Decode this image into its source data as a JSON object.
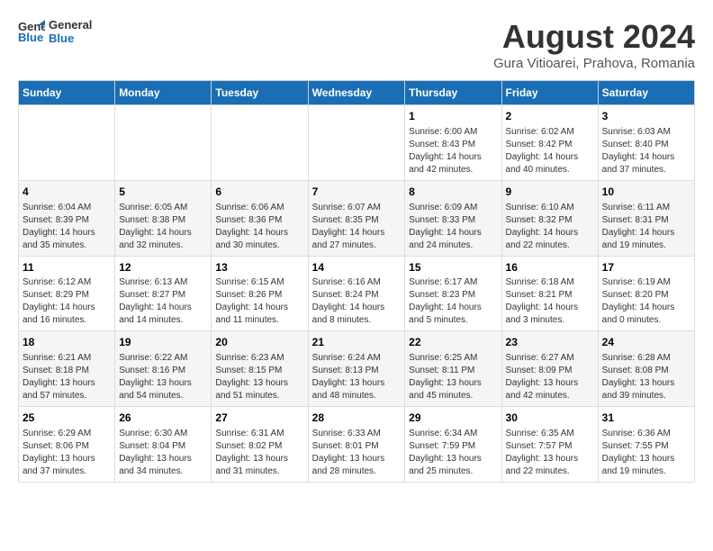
{
  "logo": {
    "line1": "General",
    "line2": "Blue"
  },
  "title": "August 2024",
  "subtitle": "Gura Vitioarei, Prahova, Romania",
  "header_days": [
    "Sunday",
    "Monday",
    "Tuesday",
    "Wednesday",
    "Thursday",
    "Friday",
    "Saturday"
  ],
  "weeks": [
    [
      {
        "day": "",
        "info": ""
      },
      {
        "day": "",
        "info": ""
      },
      {
        "day": "",
        "info": ""
      },
      {
        "day": "",
        "info": ""
      },
      {
        "day": "1",
        "info": "Sunrise: 6:00 AM\nSunset: 8:43 PM\nDaylight: 14 hours\nand 42 minutes."
      },
      {
        "day": "2",
        "info": "Sunrise: 6:02 AM\nSunset: 8:42 PM\nDaylight: 14 hours\nand 40 minutes."
      },
      {
        "day": "3",
        "info": "Sunrise: 6:03 AM\nSunset: 8:40 PM\nDaylight: 14 hours\nand 37 minutes."
      }
    ],
    [
      {
        "day": "4",
        "info": "Sunrise: 6:04 AM\nSunset: 8:39 PM\nDaylight: 14 hours\nand 35 minutes."
      },
      {
        "day": "5",
        "info": "Sunrise: 6:05 AM\nSunset: 8:38 PM\nDaylight: 14 hours\nand 32 minutes."
      },
      {
        "day": "6",
        "info": "Sunrise: 6:06 AM\nSunset: 8:36 PM\nDaylight: 14 hours\nand 30 minutes."
      },
      {
        "day": "7",
        "info": "Sunrise: 6:07 AM\nSunset: 8:35 PM\nDaylight: 14 hours\nand 27 minutes."
      },
      {
        "day": "8",
        "info": "Sunrise: 6:09 AM\nSunset: 8:33 PM\nDaylight: 14 hours\nand 24 minutes."
      },
      {
        "day": "9",
        "info": "Sunrise: 6:10 AM\nSunset: 8:32 PM\nDaylight: 14 hours\nand 22 minutes."
      },
      {
        "day": "10",
        "info": "Sunrise: 6:11 AM\nSunset: 8:31 PM\nDaylight: 14 hours\nand 19 minutes."
      }
    ],
    [
      {
        "day": "11",
        "info": "Sunrise: 6:12 AM\nSunset: 8:29 PM\nDaylight: 14 hours\nand 16 minutes."
      },
      {
        "day": "12",
        "info": "Sunrise: 6:13 AM\nSunset: 8:27 PM\nDaylight: 14 hours\nand 14 minutes."
      },
      {
        "day": "13",
        "info": "Sunrise: 6:15 AM\nSunset: 8:26 PM\nDaylight: 14 hours\nand 11 minutes."
      },
      {
        "day": "14",
        "info": "Sunrise: 6:16 AM\nSunset: 8:24 PM\nDaylight: 14 hours\nand 8 minutes."
      },
      {
        "day": "15",
        "info": "Sunrise: 6:17 AM\nSunset: 8:23 PM\nDaylight: 14 hours\nand 5 minutes."
      },
      {
        "day": "16",
        "info": "Sunrise: 6:18 AM\nSunset: 8:21 PM\nDaylight: 14 hours\nand 3 minutes."
      },
      {
        "day": "17",
        "info": "Sunrise: 6:19 AM\nSunset: 8:20 PM\nDaylight: 14 hours\nand 0 minutes."
      }
    ],
    [
      {
        "day": "18",
        "info": "Sunrise: 6:21 AM\nSunset: 8:18 PM\nDaylight: 13 hours\nand 57 minutes."
      },
      {
        "day": "19",
        "info": "Sunrise: 6:22 AM\nSunset: 8:16 PM\nDaylight: 13 hours\nand 54 minutes."
      },
      {
        "day": "20",
        "info": "Sunrise: 6:23 AM\nSunset: 8:15 PM\nDaylight: 13 hours\nand 51 minutes."
      },
      {
        "day": "21",
        "info": "Sunrise: 6:24 AM\nSunset: 8:13 PM\nDaylight: 13 hours\nand 48 minutes."
      },
      {
        "day": "22",
        "info": "Sunrise: 6:25 AM\nSunset: 8:11 PM\nDaylight: 13 hours\nand 45 minutes."
      },
      {
        "day": "23",
        "info": "Sunrise: 6:27 AM\nSunset: 8:09 PM\nDaylight: 13 hours\nand 42 minutes."
      },
      {
        "day": "24",
        "info": "Sunrise: 6:28 AM\nSunset: 8:08 PM\nDaylight: 13 hours\nand 39 minutes."
      }
    ],
    [
      {
        "day": "25",
        "info": "Sunrise: 6:29 AM\nSunset: 8:06 PM\nDaylight: 13 hours\nand 37 minutes."
      },
      {
        "day": "26",
        "info": "Sunrise: 6:30 AM\nSunset: 8:04 PM\nDaylight: 13 hours\nand 34 minutes."
      },
      {
        "day": "27",
        "info": "Sunrise: 6:31 AM\nSunset: 8:02 PM\nDaylight: 13 hours\nand 31 minutes."
      },
      {
        "day": "28",
        "info": "Sunrise: 6:33 AM\nSunset: 8:01 PM\nDaylight: 13 hours\nand 28 minutes."
      },
      {
        "day": "29",
        "info": "Sunrise: 6:34 AM\nSunset: 7:59 PM\nDaylight: 13 hours\nand 25 minutes."
      },
      {
        "day": "30",
        "info": "Sunrise: 6:35 AM\nSunset: 7:57 PM\nDaylight: 13 hours\nand 22 minutes."
      },
      {
        "day": "31",
        "info": "Sunrise: 6:36 AM\nSunset: 7:55 PM\nDaylight: 13 hours\nand 19 minutes."
      }
    ]
  ]
}
